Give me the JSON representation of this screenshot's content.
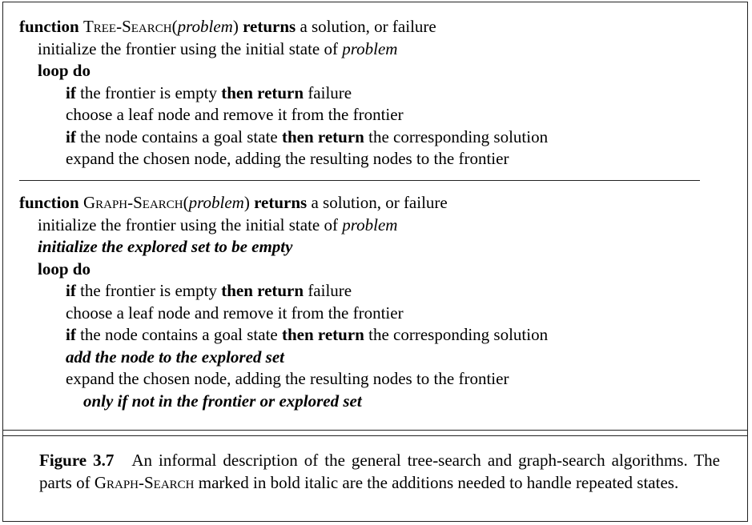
{
  "tree_search": {
    "lines": [
      {
        "indent": 0,
        "parts": [
          {
            "t": "function ",
            "s": "kw"
          },
          {
            "t": "Tree-Search",
            "s": "sc"
          },
          {
            "t": "(",
            "s": ""
          },
          {
            "t": "problem",
            "s": "var"
          },
          {
            "t": ") ",
            "s": ""
          },
          {
            "t": "returns",
            "s": "kw"
          },
          {
            "t": " a solution, or failure",
            "s": ""
          }
        ]
      },
      {
        "indent": 1,
        "parts": [
          {
            "t": "initialize the frontier using the initial state of ",
            "s": ""
          },
          {
            "t": "problem",
            "s": "var"
          }
        ]
      },
      {
        "indent": 1,
        "parts": [
          {
            "t": "loop do",
            "s": "kw"
          }
        ]
      },
      {
        "indent": 2,
        "parts": [
          {
            "t": "if",
            "s": "kw"
          },
          {
            "t": " the frontier is empty ",
            "s": ""
          },
          {
            "t": "then return",
            "s": "kw"
          },
          {
            "t": " failure",
            "s": ""
          }
        ]
      },
      {
        "indent": 2,
        "parts": [
          {
            "t": "choose a leaf node and remove it from the frontier",
            "s": ""
          }
        ]
      },
      {
        "indent": 2,
        "parts": [
          {
            "t": "if",
            "s": "kw"
          },
          {
            "t": " the node contains a goal state ",
            "s": ""
          },
          {
            "t": "then return",
            "s": "kw"
          },
          {
            "t": " the corresponding solution",
            "s": ""
          }
        ]
      },
      {
        "indent": 2,
        "parts": [
          {
            "t": "expand the chosen node, adding the resulting nodes to the frontier",
            "s": ""
          }
        ]
      }
    ]
  },
  "graph_search": {
    "lines": [
      {
        "indent": 0,
        "parts": [
          {
            "t": "function ",
            "s": "kw"
          },
          {
            "t": "Graph-Search",
            "s": "sc"
          },
          {
            "t": "(",
            "s": ""
          },
          {
            "t": "problem",
            "s": "var"
          },
          {
            "t": ") ",
            "s": ""
          },
          {
            "t": "returns",
            "s": "kw"
          },
          {
            "t": " a solution, or failure",
            "s": ""
          }
        ]
      },
      {
        "indent": 1,
        "parts": [
          {
            "t": "initialize the frontier using the initial state of ",
            "s": ""
          },
          {
            "t": "problem",
            "s": "var"
          }
        ]
      },
      {
        "indent": 1,
        "parts": [
          {
            "t": "initialize the explored set to be empty",
            "s": "add"
          }
        ]
      },
      {
        "indent": 1,
        "parts": [
          {
            "t": "loop do",
            "s": "kw"
          }
        ]
      },
      {
        "indent": 2,
        "parts": [
          {
            "t": "if",
            "s": "kw"
          },
          {
            "t": " the frontier is empty ",
            "s": ""
          },
          {
            "t": "then return",
            "s": "kw"
          },
          {
            "t": " failure",
            "s": ""
          }
        ]
      },
      {
        "indent": 2,
        "parts": [
          {
            "t": "choose a leaf node and remove it from the frontier",
            "s": ""
          }
        ]
      },
      {
        "indent": 2,
        "parts": [
          {
            "t": "if",
            "s": "kw"
          },
          {
            "t": " the node contains a goal state ",
            "s": ""
          },
          {
            "t": "then return",
            "s": "kw"
          },
          {
            "t": " the corresponding solution",
            "s": ""
          }
        ]
      },
      {
        "indent": 2,
        "parts": [
          {
            "t": "add the node to the explored set",
            "s": "add"
          }
        ]
      },
      {
        "indent": 2,
        "parts": [
          {
            "t": "expand the chosen node, adding the resulting nodes to the frontier",
            "s": ""
          }
        ]
      },
      {
        "indent": 3,
        "parts": [
          {
            "t": "only if not in the frontier or explored set",
            "s": "add"
          }
        ]
      }
    ]
  },
  "caption": {
    "label": "Figure 3.7",
    "text_before": "An informal description of the general tree-search and graph-search algorithms.  The parts of ",
    "name": "Graph-Search",
    "text_after": " marked in bold italic are the additions needed to handle repeated states."
  }
}
